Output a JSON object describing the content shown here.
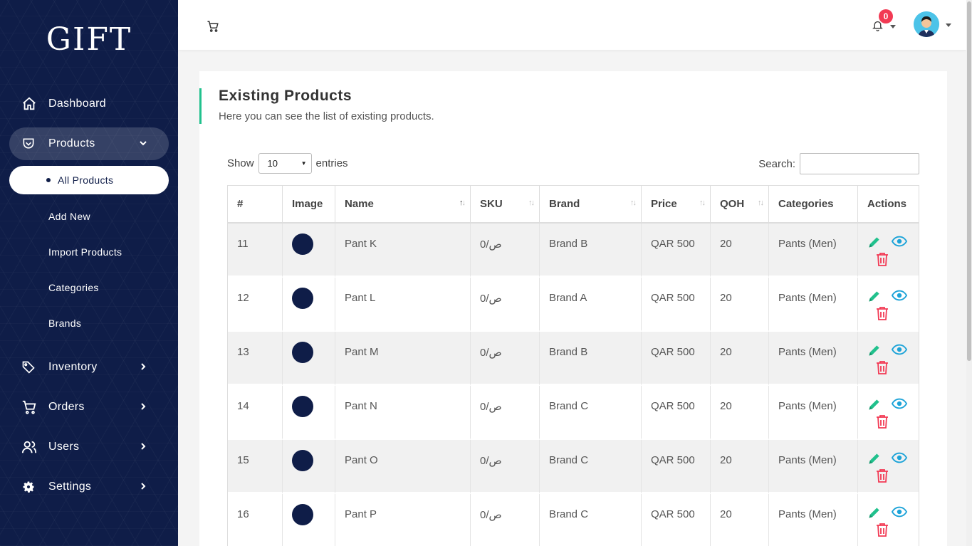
{
  "brand": {
    "logo_text": "GIFT"
  },
  "sidebar": {
    "items": [
      {
        "label": "Dashboard",
        "icon": "home-icon"
      },
      {
        "label": "Products",
        "icon": "shield-icon",
        "expanded": true
      },
      {
        "label": "Inventory",
        "icon": "tag-icon"
      },
      {
        "label": "Orders",
        "icon": "cart-icon"
      },
      {
        "label": "Users",
        "icon": "users-icon"
      },
      {
        "label": "Settings",
        "icon": "gear-icon"
      }
    ],
    "subitems": [
      {
        "label": "All Products",
        "current": true
      },
      {
        "label": "Add New"
      },
      {
        "label": "Import Products"
      },
      {
        "label": "Categories"
      },
      {
        "label": "Brands"
      }
    ]
  },
  "header": {
    "notification_count": "0",
    "icons": [
      "cart-icon",
      "bell-icon",
      "avatar"
    ]
  },
  "page": {
    "title": "Existing Products",
    "subtitle": "Here you can see the list of existing products.",
    "show_label": "Show",
    "entries_value": "10",
    "entries_label": "entries",
    "search_label": "Search:",
    "search_value": ""
  },
  "table": {
    "columns": [
      "#",
      "Image",
      "Name",
      "SKU",
      "Brand",
      "Price",
      "QOH",
      "Categories",
      "Actions"
    ],
    "rows": [
      {
        "id": "11",
        "name": "Pant K",
        "sku": "ص/0",
        "brand": "Brand B",
        "price": "QAR 500",
        "qoh": "20",
        "category": "Pants (Men)"
      },
      {
        "id": "12",
        "name": "Pant L",
        "sku": "ص/0",
        "brand": "Brand A",
        "price": "QAR 500",
        "qoh": "20",
        "category": "Pants (Men)"
      },
      {
        "id": "13",
        "name": "Pant M",
        "sku": "ص/0",
        "brand": "Brand B",
        "price": "QAR 500",
        "qoh": "20",
        "category": "Pants (Men)"
      },
      {
        "id": "14",
        "name": "Pant N",
        "sku": "ص/0",
        "brand": "Brand C",
        "price": "QAR 500",
        "qoh": "20",
        "category": "Pants (Men)"
      },
      {
        "id": "15",
        "name": "Pant O",
        "sku": "ص/0",
        "brand": "Brand C",
        "price": "QAR 500",
        "qoh": "20",
        "category": "Pants (Men)"
      },
      {
        "id": "16",
        "name": "Pant P",
        "sku": "ص/0",
        "brand": "Brand C",
        "price": "QAR 500",
        "qoh": "20",
        "category": "Pants (Men)"
      }
    ]
  },
  "colors": {
    "sidebar": "#0f1d48",
    "accent_green": "#21c18d",
    "view_blue": "#1ca3d8",
    "delete_red": "#f23a54",
    "badge": "#f23a54"
  }
}
